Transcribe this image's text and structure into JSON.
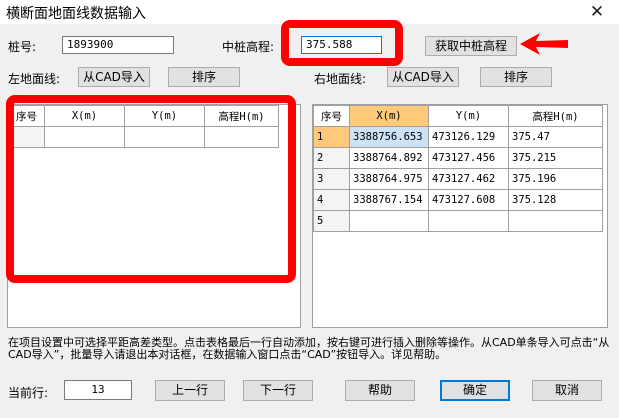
{
  "window": {
    "title": "横断面地面线数据输入",
    "close_glyph": "✕"
  },
  "form": {
    "pile_label": "桩号:",
    "pile_value": "1893900",
    "center_elev_label": "中桩高程:",
    "center_elev_value": "375.588",
    "get_elev_button": "获取中桩高程"
  },
  "left": {
    "label": "左地面线:",
    "import_button": "从CAD导入",
    "sort_button": "排序",
    "headers": [
      "序号",
      "X(m)",
      "Y(m)",
      "高程H(m)"
    ]
  },
  "right": {
    "label": "右地面线:",
    "import_button": "从CAD导入",
    "sort_button": "排序",
    "headers": [
      "序号",
      "X(m)",
      "Y(m)",
      "高程H(m)"
    ],
    "rows": [
      [
        "1",
        "3388756.653",
        "473126.129",
        "375.47"
      ],
      [
        "2",
        "3388764.892",
        "473127.456",
        "375.215"
      ],
      [
        "3",
        "3388764.975",
        "473127.462",
        "375.196"
      ],
      [
        "4",
        "3388767.154",
        "473127.608",
        "375.128"
      ],
      [
        "5",
        "",
        "",
        ""
      ]
    ]
  },
  "info_text": "在项目设置中可选择平距高差类型。点击表格最后一行自动添加，按右键可进行插入删除等操作。从CAD单条导入可点击“从CAD导入”，批量导入请退出本对话框，在数据输入窗口点击“CAD”按钮导入。详见帮助。",
  "footer": {
    "current_row_label": "当前行:",
    "current_row_value": "13",
    "prev_button": "上一行",
    "next_button": "下一行",
    "help_button": "帮助",
    "ok_button": "确定",
    "cancel_button": "取消"
  },
  "annotation_color": "#ff0000",
  "accent_color": "#0078d7",
  "highlight_color": "#ffc97a"
}
